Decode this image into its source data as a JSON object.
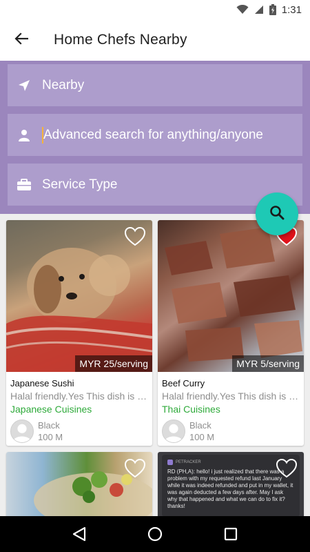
{
  "status_bar": {
    "time": "1:31"
  },
  "app_bar": {
    "title": "Home Chefs Nearby"
  },
  "search": {
    "nearby_label": "Nearby",
    "advanced_placeholder": "Advanced search for anything/anyone",
    "service_type_label": "Service Type"
  },
  "colors": {
    "panel": "#9b86bd",
    "field": "#ad9dcc",
    "fab": "#1ec9b5",
    "cuisine": "#2eaa3a",
    "heart_active": "#e0121a"
  },
  "cards": [
    {
      "price": "MYR 25/serving",
      "name": "Japanese Sushi",
      "description": "Halal friendly.Yes This dish is av...",
      "cuisine": "Japanese Cuisines",
      "chef": "Black",
      "distance": "100 M",
      "favorited": false
    },
    {
      "price": "MYR 5/serving",
      "name": "Beef Curry",
      "description": "Halal friendly.Yes This dish is av...",
      "cuisine": "Thai Cuisines",
      "chef": "Black",
      "distance": "100 M",
      "favorited": true
    },
    {
      "favorited": false
    },
    {
      "favorited": false,
      "chat_header": "PETRACKER",
      "chat_text": "RD (PH,A): hello! i just realized that there was a problem with my requested refund last January while it was indeed refunded and put in my wallet, it was again deducted a few days after. May I ask why that happened and what we can do to fix it? thanks!"
    }
  ]
}
